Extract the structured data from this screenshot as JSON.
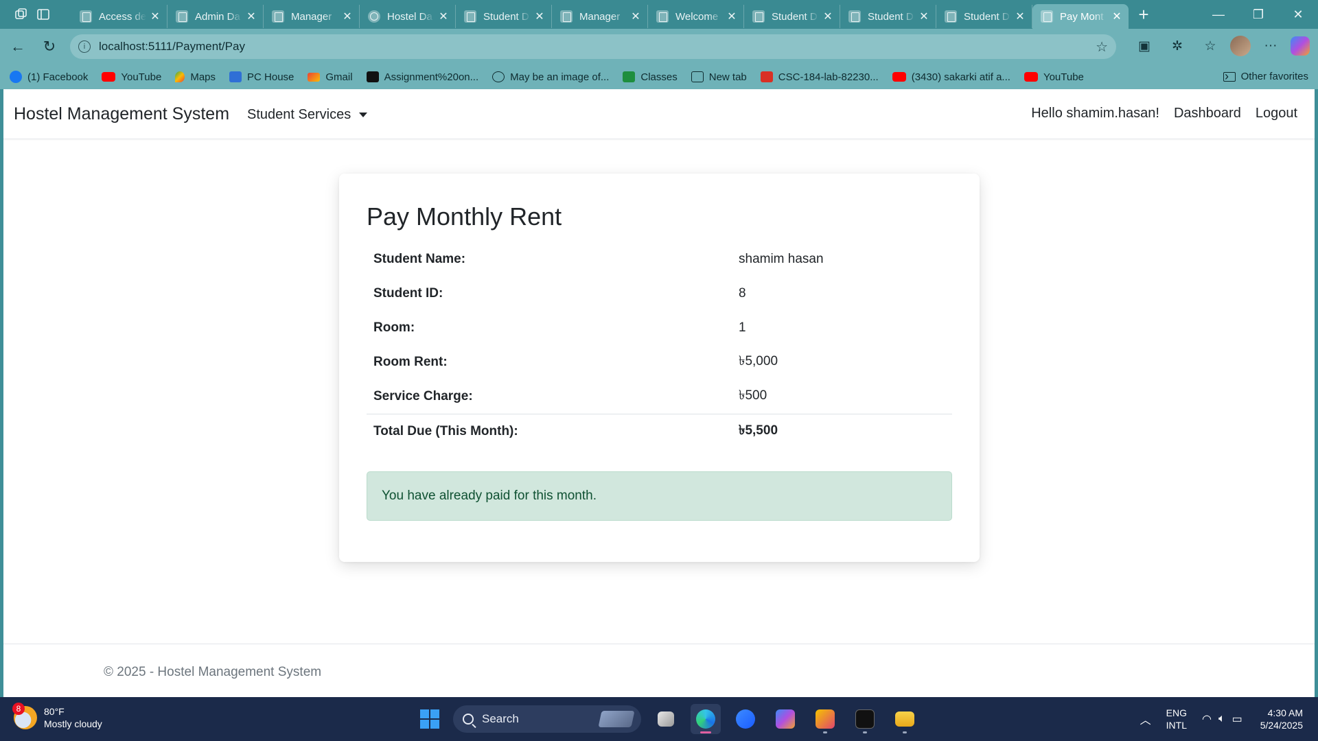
{
  "browser": {
    "tabs": [
      {
        "label": "Access de",
        "icon": "page-icon"
      },
      {
        "label": "Admin Da",
        "icon": "page-icon"
      },
      {
        "label": "Manager",
        "icon": "page-icon"
      },
      {
        "label": "Hostel Da",
        "icon": "globe-icon"
      },
      {
        "label": "Student D",
        "icon": "page-icon"
      },
      {
        "label": "Manager",
        "icon": "page-icon"
      },
      {
        "label": "Welcome",
        "icon": "page-icon"
      },
      {
        "label": "Student D",
        "icon": "page-icon"
      },
      {
        "label": "Student D",
        "icon": "page-icon"
      },
      {
        "label": "Student D",
        "icon": "page-icon"
      },
      {
        "label": "Pay Mont",
        "icon": "page-icon"
      }
    ],
    "active_tab_index": 10,
    "url": "localhost:5111/Payment/Pay",
    "bookmarks": [
      {
        "label": "(1) Facebook",
        "icon": "fb"
      },
      {
        "label": "YouTube",
        "icon": "yt"
      },
      {
        "label": "Maps",
        "icon": "maps"
      },
      {
        "label": "PC House",
        "icon": "pc"
      },
      {
        "label": "Gmail",
        "icon": "gm"
      },
      {
        "label": "Assignment%20on...",
        "icon": "doc"
      },
      {
        "label": "May be an image of...",
        "icon": "web"
      },
      {
        "label": "Classes",
        "icon": "cls"
      },
      {
        "label": "New tab",
        "icon": "nt"
      },
      {
        "label": "CSC-184-lab-82230...",
        "icon": "pdf"
      },
      {
        "label": "(3430) sakarki atif a...",
        "icon": "yt"
      },
      {
        "label": "YouTube",
        "icon": "yt"
      }
    ],
    "other_favorites": "Other favorites"
  },
  "site": {
    "brand": "Hostel Management System",
    "services_menu": "Student Services",
    "greeting": "Hello shamim.hasan!",
    "dashboard": "Dashboard",
    "logout": "Logout"
  },
  "card": {
    "title": "Pay Monthly Rent",
    "rows": [
      {
        "label": "Student Name:",
        "value": "shamim hasan"
      },
      {
        "label": "Student ID:",
        "value": "8"
      },
      {
        "label": "Room:",
        "value": "1"
      },
      {
        "label": "Room Rent:",
        "value": "৳5,000"
      },
      {
        "label": "Service Charge:",
        "value": "৳500"
      }
    ],
    "total": {
      "label": "Total Due (This Month):",
      "value": "৳5,500"
    },
    "alert": "You have already paid for this month."
  },
  "footer": "© 2025 - Hostel Management System",
  "taskbar": {
    "weather_badge": "8",
    "temperature": "80°F",
    "condition": "Mostly cloudy",
    "search_label": "Search",
    "lang_top": "ENG",
    "lang_bottom": "INTL",
    "time": "4:30 AM",
    "date": "5/24/2025"
  },
  "colors": {
    "browser_frame": "#3a8a92",
    "toolbar": "#6fb2b8",
    "alert_bg": "#d1e7dd",
    "alert_text": "#0f5132",
    "taskbar": "#1b2a4a"
  }
}
